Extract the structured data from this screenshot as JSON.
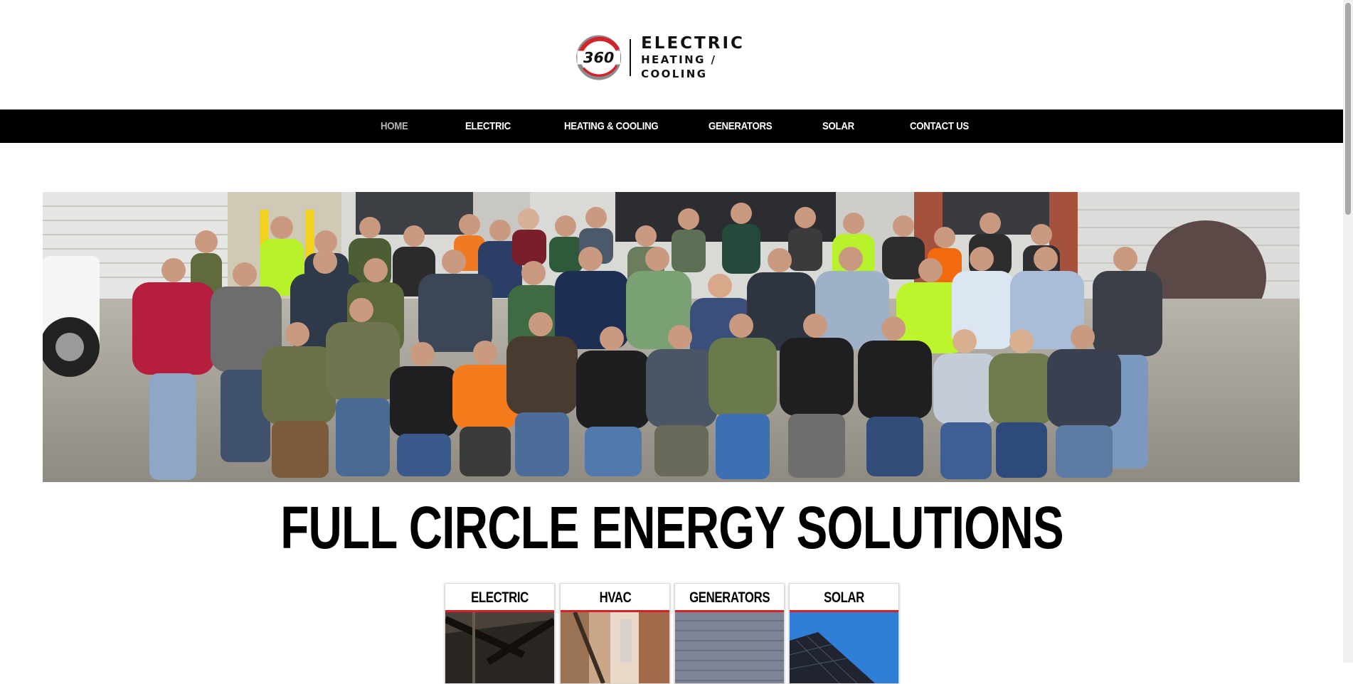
{
  "logo": {
    "mark_text": "360",
    "line1": "ELECTRIC",
    "line2": "HEATING / COOLING",
    "colors": {
      "ring_red": "#d2232a",
      "ring_gray": "#8c8c8c",
      "text": "#111111"
    }
  },
  "nav": {
    "items": [
      {
        "label": "HOME",
        "active": true
      },
      {
        "label": "ELECTRIC"
      },
      {
        "label": "HEATING & COOLING"
      },
      {
        "label": "GENERATORS"
      },
      {
        "label": "SOLAR"
      },
      {
        "label": "CONTACT US"
      }
    ],
    "background": "#000000",
    "active_color": "#b5b5b5"
  },
  "hero": {
    "image": "team-group-photo"
  },
  "main": {
    "heading": "FULL CIRCLE ENERGY SOLUTIONS"
  },
  "services": [
    {
      "label": "ELECTRIC",
      "image": "electric-image"
    },
    {
      "label": "HVAC",
      "image": "hvac-image"
    },
    {
      "label": "GENERATORS",
      "image": "generators-image"
    },
    {
      "label": "SOLAR",
      "image": "solar-image"
    }
  ],
  "accent_color": "#d2232a"
}
